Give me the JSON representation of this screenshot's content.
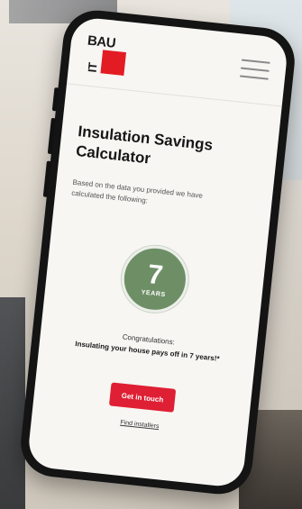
{
  "brand": {
    "logo_line1": "BAU",
    "logo_line2": "IT"
  },
  "calculator": {
    "title": "Insulation Savings Calculator",
    "intro": "Based on the data you provided we have calculated the following:",
    "payback_value": "7",
    "payback_unit": "YEARS",
    "congrats": "Congratulations:",
    "result": "Insulating your house pays off in 7 years!*",
    "cta_label": "Get in touch",
    "link_label": "Find installers"
  },
  "colors": {
    "brand_red": "#e31b23",
    "cta_red": "#df1f33",
    "badge_green": "#6e8f66"
  },
  "icons": {
    "menu": "hamburger-menu-icon"
  }
}
